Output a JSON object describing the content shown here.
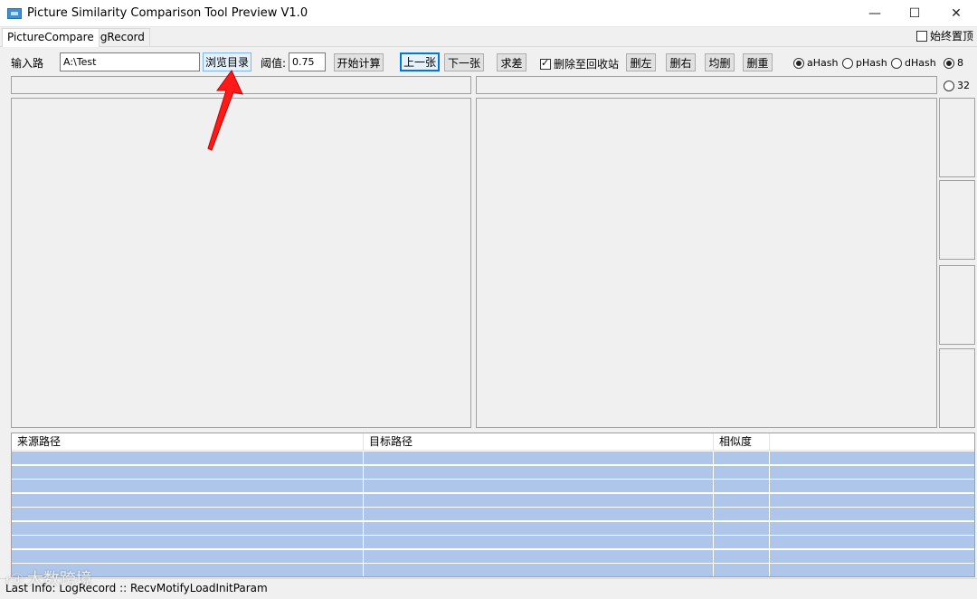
{
  "window": {
    "title": "Picture Similarity Comparison Tool Preview V1.0",
    "minimize_glyph": "—",
    "maximize_glyph": "☐",
    "close_glyph": "✕"
  },
  "tabs": [
    {
      "label": "PictureCompare",
      "active": true
    },
    {
      "label": "LogRecord",
      "active": false
    }
  ],
  "topmost": {
    "label": "始终置顶",
    "checked": false
  },
  "toolbar": {
    "input_path_label": "输入路",
    "input_path_value": "A:\\Test",
    "browse_label": "浏览目录",
    "threshold_label": "阈值:",
    "threshold_value": "0.75",
    "start_label": "开始计算",
    "prev_label": "上一张",
    "next_label": "下一张",
    "diff_label": "求差",
    "delete_to_recycle_label": "删除至回收站",
    "delete_to_recycle_checked": true,
    "delete_left_label": "删左",
    "delete_right_label": "删右",
    "delete_both_label": "均删",
    "delete_dup_label": "删重"
  },
  "hash_options": [
    {
      "label": "aHash",
      "selected": true
    },
    {
      "label": "pHash",
      "selected": false
    },
    {
      "label": "dHash",
      "selected": false
    }
  ],
  "size_options": [
    {
      "label": "8",
      "selected": true
    },
    {
      "label": "32",
      "selected": false
    }
  ],
  "table": {
    "columns": [
      "来源路径",
      "目标路径",
      "相似度",
      ""
    ],
    "rows": [
      [
        "",
        "",
        "",
        ""
      ],
      [
        "",
        "",
        "",
        ""
      ],
      [
        "",
        "",
        "",
        ""
      ],
      [
        "",
        "",
        "",
        ""
      ],
      [
        "",
        "",
        "",
        ""
      ],
      [
        "",
        "",
        "",
        ""
      ],
      [
        "",
        "",
        "",
        ""
      ],
      [
        "",
        "",
        "",
        ""
      ],
      [
        "",
        "",
        "",
        ""
      ]
    ]
  },
  "status": {
    "text": "Last Info: LogRecord  :: RecvMotifyLoadInitParam"
  },
  "watermark": "大数跨境",
  "colors": {
    "selected_row": "#aec6ea",
    "focus_border": "#0078d7",
    "annotation_arrow": "#ff1a1a"
  }
}
